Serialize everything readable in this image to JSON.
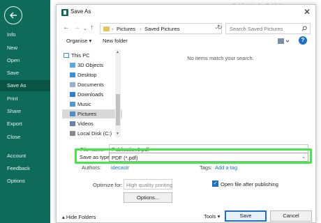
{
  "backstage": {
    "nav": [
      {
        "label": "Info"
      },
      {
        "label": "New"
      },
      {
        "label": "Open"
      },
      {
        "label": "Save"
      },
      {
        "label": "Save As",
        "active": true
      },
      {
        "label": "Print"
      },
      {
        "label": "Share"
      },
      {
        "label": "Export"
      },
      {
        "label": "Close"
      },
      {
        "label": "Account"
      },
      {
        "label": "Feedback"
      },
      {
        "label": "Options"
      }
    ],
    "accent_color": "#0e6b5a"
  },
  "window_title_partial": "Publication1 - Publisher",
  "dialog": {
    "title": "Save As",
    "close_label": "✕",
    "breadcrumb": [
      "Pictures",
      "Saved Pictures"
    ],
    "search_placeholder": "Search Saved Pictures",
    "toolbar": {
      "organise": "Organise ▾",
      "new_folder": "New folder",
      "help": "?"
    },
    "tree": [
      {
        "label": "This PC",
        "icon": "computer-icon"
      },
      {
        "label": "3D Objects",
        "icon": "cube-icon"
      },
      {
        "label": "Desktop",
        "icon": "desktop-icon"
      },
      {
        "label": "Documents",
        "icon": "documents-icon"
      },
      {
        "label": "Downloads",
        "icon": "download-icon"
      },
      {
        "label": "Music",
        "icon": "music-icon"
      },
      {
        "label": "Pictures",
        "icon": "pictures-icon",
        "selected": true
      },
      {
        "label": "Videos",
        "icon": "videos-icon"
      },
      {
        "label": "Local Disk (C:)",
        "icon": "disk-icon"
      }
    ],
    "empty_message": "No items match your search.",
    "file_name_label": "File name:",
    "file_name_value": "Publication1.pdf",
    "save_as_type_label": "Save as type:",
    "save_as_type_value": "PDF (*.pdf)",
    "authors_label": "Authors:",
    "authors_value": "idecastr",
    "tags_label": "Tags:",
    "tags_value": "Add a tag",
    "optimize_label": "Optimize for:",
    "optimize_value": "High quality printing",
    "options_button": "Options...",
    "open_after_label": "Open file after publishing",
    "open_after_checked": true,
    "hide_folders": "Hide Folders",
    "tools": "Tools ▾",
    "save_button": "Save",
    "cancel_button": "Cancel"
  }
}
